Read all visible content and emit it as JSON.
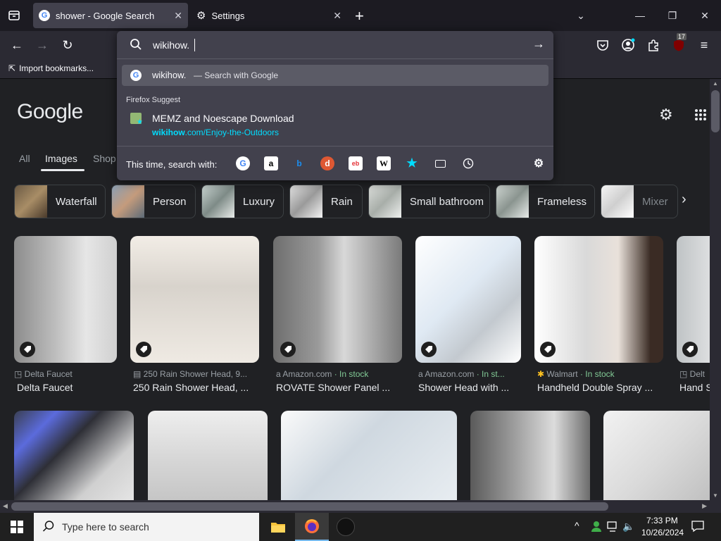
{
  "browser": {
    "tabs": [
      {
        "label": "shower - Google Search",
        "icon": "google-g-icon"
      },
      {
        "label": "Settings",
        "icon": "gear-icon"
      }
    ],
    "new_tab": "+",
    "url_value": "wikihow.",
    "bookmarks": {
      "import_label": "Import bookmarks..."
    },
    "badge_count": "17"
  },
  "urlbar_dropdown": {
    "primary_suggestion": {
      "query": "wikihow.",
      "suffix": "— Search with Google"
    },
    "section_heading": "Firefox Suggest",
    "sponsored": {
      "title": "MEMZ and Noescape Download",
      "url_domain": "wikihow",
      "url_path": ".com/Enjoy-the-Outdoors"
    },
    "search_with_label": "This time, search with:",
    "engines": [
      "google",
      "amazon",
      "bing",
      "duckduckgo",
      "ebay",
      "wikipedia",
      "bookmarks",
      "tabs",
      "history"
    ]
  },
  "google": {
    "logo": "Google",
    "tabs": [
      "All",
      "Images",
      "Shop"
    ],
    "active_tab": "Images",
    "chips": [
      "Waterfall",
      "Person",
      "Luxury",
      "Rain",
      "Small bathroom",
      "Frameless",
      "Mixer"
    ],
    "results_row1": [
      {
        "source": "Delta Faucet",
        "stock": "",
        "title": "Delta Faucet"
      },
      {
        "source": "250 Rain Shower Head, 9...",
        "stock": "",
        "title": "250 Rain Shower Head, ..."
      },
      {
        "source": "Amazon.com",
        "stock": " · In stock",
        "title": "ROVATE Shower Panel ..."
      },
      {
        "source": "Amazon.com",
        "stock": " · In st...",
        "title": "Shower Head with ..."
      },
      {
        "source": "Walmart",
        "stock": " · In stock",
        "title": "Handheld Double Spray ..."
      },
      {
        "source": "Delt",
        "stock": "",
        "title": "Hand S"
      }
    ]
  },
  "taskbar": {
    "search_placeholder": "Type here to search",
    "time": "7:33 PM",
    "date": "10/26/2024"
  },
  "colors": {
    "accent_link": "#00ddff",
    "in_stock": "#81c995"
  }
}
